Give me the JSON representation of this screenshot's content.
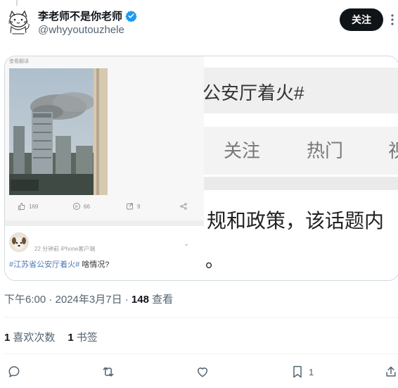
{
  "author": {
    "name": "李老师不是你老师",
    "handle": "@whyyoutouzhele",
    "verified": true
  },
  "follow_label": "关注",
  "media": {
    "left": {
      "top_caption": "查看翻译",
      "stats": {
        "likes": "169",
        "comments": "66",
        "reposts": "9"
      },
      "comment": {
        "meta": "22 分钟前   iPhone客户端",
        "hashtag": "#江苏省公安厅着火#",
        "text": " 啥情况?"
      }
    },
    "right": {
      "title": "公安厅着火#",
      "tabs": [
        "关注",
        "热门",
        "视"
      ],
      "body": "规和政策，该话题内",
      "period": "。"
    }
  },
  "timestamp": {
    "time": "下午6:00 · 2024年3月7日 · ",
    "views_count": "148",
    "views_label": " 查看"
  },
  "counts": {
    "likes_num": "1",
    "likes_label": "喜欢次数",
    "bookmarks_num": "1",
    "bookmarks_label": "书签"
  },
  "actions": {
    "bookmark_count": "1"
  },
  "colors": {
    "follow_bg": "#0f1419",
    "verified": "#1d9bf0",
    "muted": "#536471",
    "hashtag": "#4a79b6"
  }
}
